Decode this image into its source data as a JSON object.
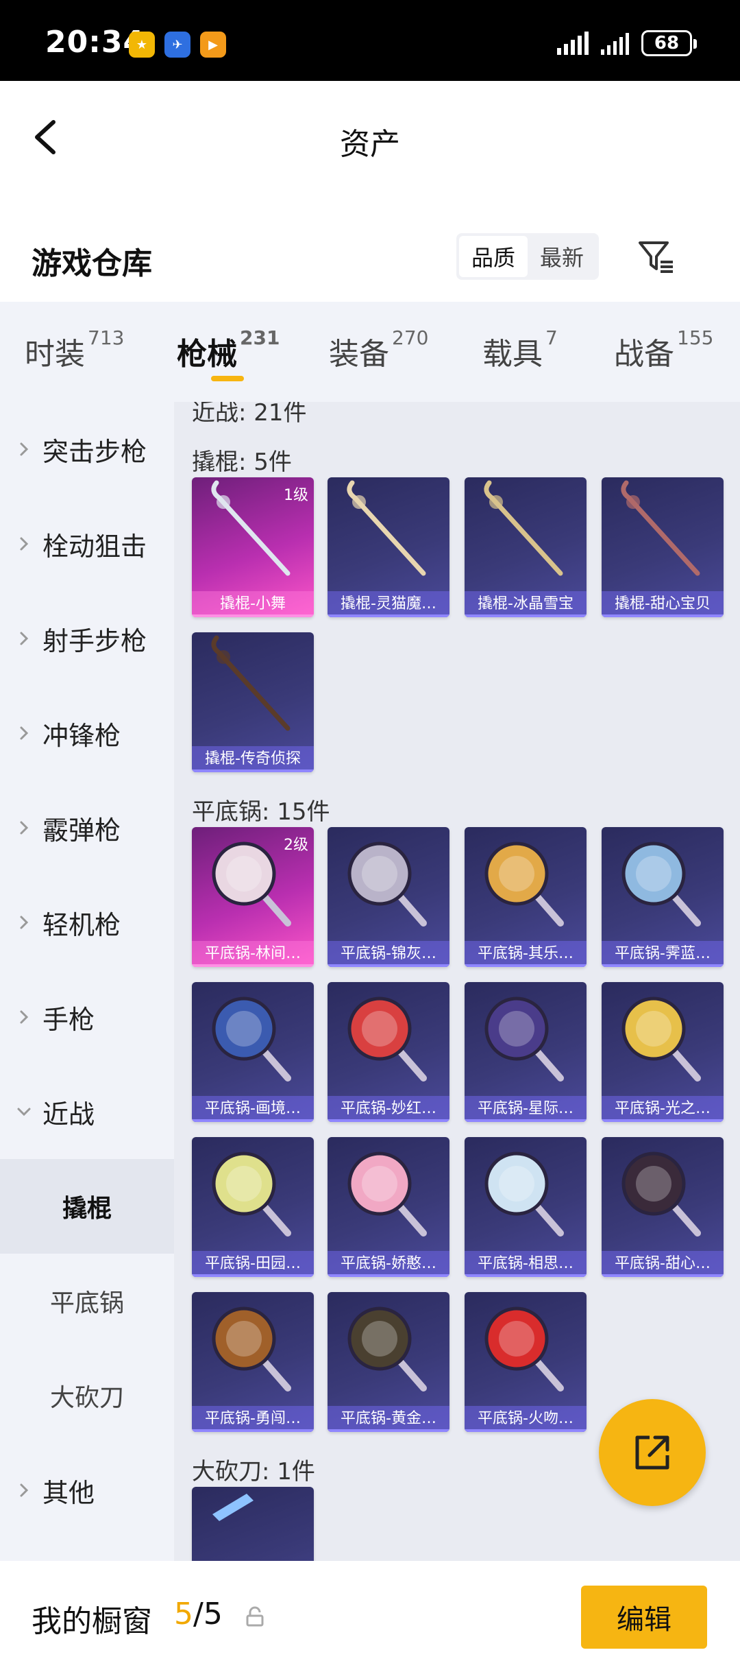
{
  "status_bar": {
    "time": "20:34",
    "app_icons": [
      {
        "name": "app-1-icon",
        "color": "#f2b705",
        "glyph": "★"
      },
      {
        "name": "app-2-icon",
        "color": "#2e6fe0",
        "glyph": "✈"
      },
      {
        "name": "app-3-icon",
        "color": "#f39a1a",
        "glyph": "▶"
      }
    ],
    "battery": "68"
  },
  "nav": {
    "title": "资产"
  },
  "header": {
    "heading": "游戏仓库",
    "sort_options": [
      "品质",
      "最新"
    ],
    "sort_active_index": 0
  },
  "tabs": [
    {
      "label": "时装",
      "count": "713"
    },
    {
      "label": "枪械",
      "count": "231"
    },
    {
      "label": "装备",
      "count": "270"
    },
    {
      "label": "载具",
      "count": "7"
    },
    {
      "label": "战备",
      "count": "155"
    }
  ],
  "active_tab_index": 1,
  "sidebar": {
    "items": [
      "突击步枪",
      "栓动狙击",
      "射手步枪",
      "冲锋枪",
      "霰弹枪",
      "轻机枪",
      "手枪",
      "近战"
    ],
    "sub_items": [
      "撬棍",
      "平底锅",
      "大砍刀"
    ],
    "active_sub": "撬棍",
    "last_item": "其他"
  },
  "content": {
    "cut_header": "近战: 21件",
    "sections": [
      {
        "title": "撬棍: 5件",
        "items": [
          {
            "label": "撬棍-小舞",
            "level": "1级",
            "rarity": "pink",
            "art": "crowbar"
          },
          {
            "label": "撬棍-灵猫魔…",
            "rarity": "purple",
            "art": "crowbar"
          },
          {
            "label": "撬棍-冰晶雪宝",
            "rarity": "purple",
            "art": "crowbar"
          },
          {
            "label": "撬棍-甜心宝贝",
            "rarity": "purple",
            "art": "crowbar"
          },
          {
            "label": "撬棍-传奇侦探",
            "rarity": "purple",
            "art": "crowbar"
          }
        ]
      },
      {
        "title": "平底锅: 15件",
        "items": [
          {
            "label": "平底锅-林间…",
            "level": "2级",
            "rarity": "pink",
            "art": "pan",
            "color": "#e9d7e2"
          },
          {
            "label": "平底锅-锦灰…",
            "rarity": "purple",
            "art": "pan",
            "color": "#b9b3c9"
          },
          {
            "label": "平底锅-其乐…",
            "rarity": "purple",
            "art": "pan",
            "color": "#e2a948"
          },
          {
            "label": "平底锅-霁蓝…",
            "rarity": "purple",
            "art": "pan",
            "color": "#8fb9e0"
          },
          {
            "label": "平底锅-画境…",
            "rarity": "purple",
            "art": "pan",
            "color": "#3b5bb0"
          },
          {
            "label": "平底锅-妙红…",
            "rarity": "purple",
            "art": "pan",
            "color": "#d94040"
          },
          {
            "label": "平底锅-星际…",
            "rarity": "purple",
            "art": "pan",
            "color": "#4a3c8a"
          },
          {
            "label": "平底锅-光之…",
            "rarity": "purple",
            "art": "pan",
            "color": "#e7c04a"
          },
          {
            "label": "平底锅-田园…",
            "rarity": "purple",
            "art": "pan",
            "color": "#dfe08c"
          },
          {
            "label": "平底锅-娇憨…",
            "rarity": "purple",
            "art": "pan",
            "color": "#f1a8c4"
          },
          {
            "label": "平底锅-相思…",
            "rarity": "purple",
            "art": "pan",
            "color": "#cfe3f2"
          },
          {
            "label": "平底锅-甜心…",
            "rarity": "purple",
            "art": "pan",
            "color": "#3a2a3a"
          },
          {
            "label": "平底锅-勇闯…",
            "rarity": "purple",
            "art": "pan",
            "color": "#a0602a"
          },
          {
            "label": "平底锅-黄金…",
            "rarity": "purple",
            "art": "pan",
            "color": "#4a4030"
          },
          {
            "label": "平底锅-火吻…",
            "rarity": "purple",
            "art": "pan",
            "color": "#d92c2c"
          }
        ]
      },
      {
        "title": "大砍刀: 1件",
        "items": [
          {
            "label": "",
            "rarity": "purple",
            "art": "machete"
          }
        ]
      }
    ]
  },
  "bottom": {
    "title": "我的橱窗",
    "current": "5",
    "total": "/5",
    "edit_label": "编辑"
  },
  "colors": {
    "accent": "#f6b512",
    "tab_bg": "#f1f3f9",
    "content_bg": "#e9ebf2"
  }
}
